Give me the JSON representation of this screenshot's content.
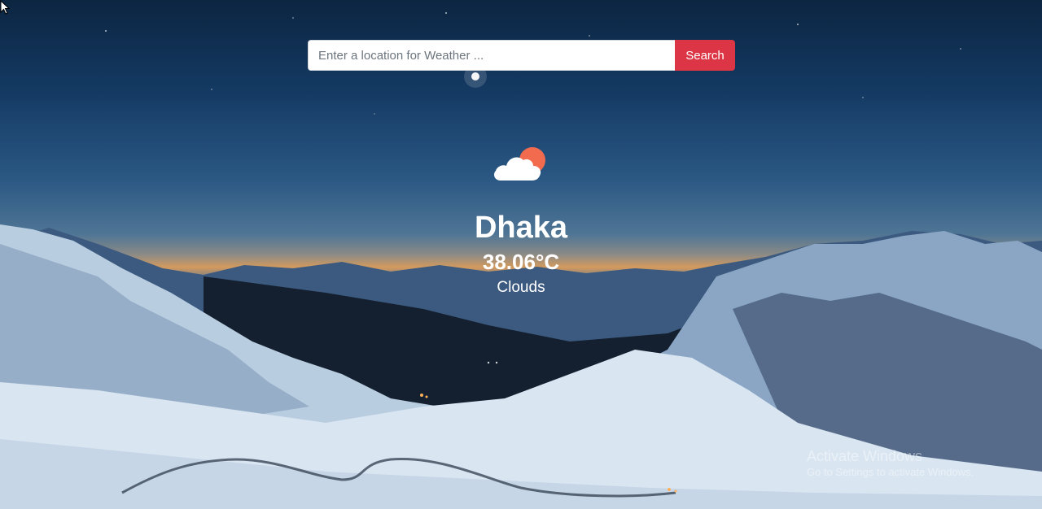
{
  "search": {
    "placeholder": "Enter a location for Weather ...",
    "value": "",
    "button_label": "Search"
  },
  "weather": {
    "icon": "partly-cloudy-icon",
    "city": "Dhaka",
    "temperature": "38.06°C",
    "condition": "Clouds"
  },
  "watermark": {
    "title": "Activate Windows",
    "subtitle": "Go to Settings to activate Windows."
  },
  "colors": {
    "search_button": "#dc3545",
    "cloud": "#ffffff",
    "sun": "#f26b4f",
    "text": "#ffffff"
  }
}
